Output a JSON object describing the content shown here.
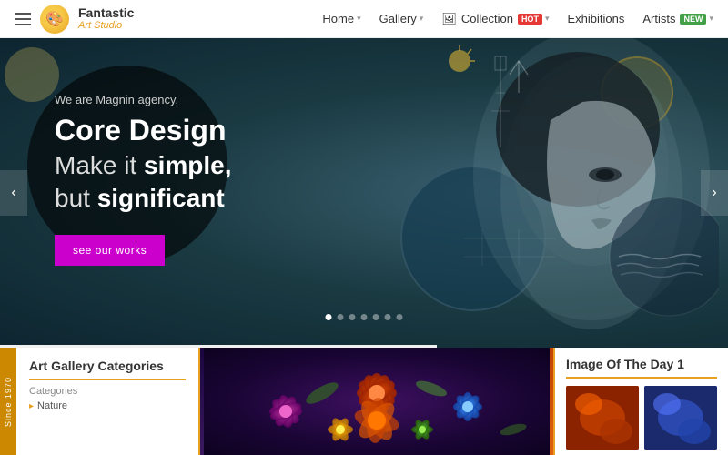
{
  "header": {
    "logo_fantastic": "Fantastic",
    "logo_studio": "Art Studio",
    "nav": [
      {
        "label": "Home",
        "has_dropdown": true
      },
      {
        "label": "Gallery",
        "has_dropdown": true
      },
      {
        "label": "Collection",
        "has_dropdown": true,
        "badge": "HOT",
        "badge_type": "hot",
        "icon": "collection-icon"
      },
      {
        "label": "Exhibitions",
        "has_dropdown": false
      },
      {
        "label": "Artists",
        "has_dropdown": true,
        "badge": "NEW",
        "badge_type": "new"
      }
    ]
  },
  "hero": {
    "subtitle": "We are Magnin agency.",
    "title_line1": "Core Design",
    "title_line2_prefix": "Make it ",
    "title_line2_bold": "simple,",
    "title_line3_prefix": "but ",
    "title_line3_bold": "significant",
    "cta_label": "see our works",
    "dots_count": 7,
    "active_dot": 0
  },
  "bottom": {
    "since_label": "Since 1970",
    "categories": {
      "title": "Art Gallery Categories",
      "label": "Categories",
      "items": [
        {
          "label": "Nature",
          "has_arrow": true
        }
      ]
    },
    "image_of_day": {
      "title": "Image Of The Day 1"
    }
  }
}
